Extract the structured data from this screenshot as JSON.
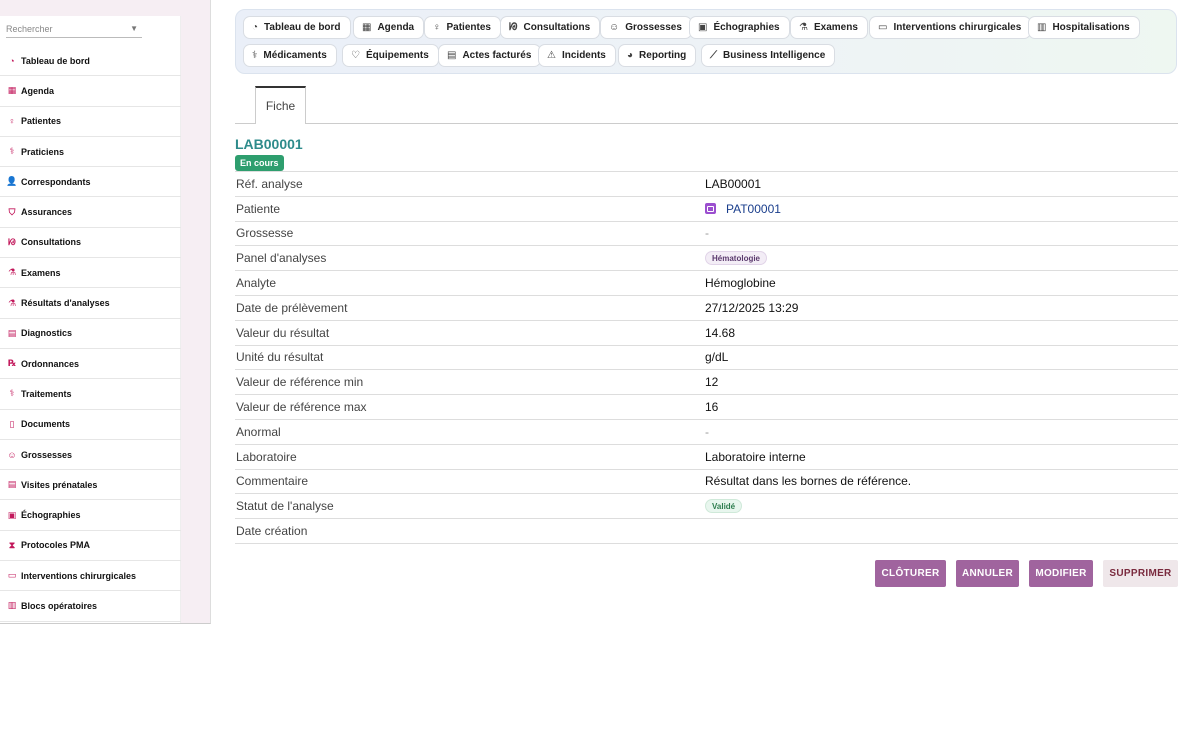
{
  "search": {
    "placeholder": "Rechercher"
  },
  "sidebar": {
    "items": [
      {
        "label": "Tableau de bord",
        "icon": "gauge-icon",
        "glyph": "◔"
      },
      {
        "label": "Agenda",
        "icon": "calendar-icon",
        "glyph": "▦"
      },
      {
        "label": "Patientes",
        "icon": "female-icon",
        "glyph": "♀"
      },
      {
        "label": "Praticiens",
        "icon": "doctor-icon",
        "glyph": "⚕"
      },
      {
        "label": "Correspondants",
        "icon": "user-icon",
        "glyph": "👤"
      },
      {
        "label": "Assurances",
        "icon": "shield-icon",
        "glyph": "⛉"
      },
      {
        "label": "Consultations",
        "icon": "stethoscope-icon",
        "glyph": "ᘘ"
      },
      {
        "label": "Examens",
        "icon": "microscope-icon",
        "glyph": "⚗"
      },
      {
        "label": "Résultats d'analyses",
        "icon": "flask-icon",
        "glyph": "⚗"
      },
      {
        "label": "Diagnostics",
        "icon": "clipboard-icon",
        "glyph": "▤"
      },
      {
        "label": "Ordonnances",
        "icon": "prescription-icon",
        "glyph": "℞"
      },
      {
        "label": "Traitements",
        "icon": "pills-icon",
        "glyph": "⚕"
      },
      {
        "label": "Documents",
        "icon": "file-icon",
        "glyph": "▯"
      },
      {
        "label": "Grossesses",
        "icon": "baby-icon",
        "glyph": "☺"
      },
      {
        "label": "Visites prénatales",
        "icon": "clipboard-check-icon",
        "glyph": "▤"
      },
      {
        "label": "Échographies",
        "icon": "monitor-icon",
        "glyph": "▣"
      },
      {
        "label": "Protocoles PMA",
        "icon": "hourglass-icon",
        "glyph": "⧗"
      },
      {
        "label": "Interventions chirurgicales",
        "icon": "bed-icon",
        "glyph": "▭"
      },
      {
        "label": "Blocs opératoires",
        "icon": "hospital-icon",
        "glyph": "▥"
      }
    ]
  },
  "topnav": {
    "items": [
      {
        "label": "Tableau de bord",
        "icon": "gauge-icon",
        "glyph": "◔"
      },
      {
        "label": "Agenda",
        "icon": "calendar-icon",
        "glyph": "▦"
      },
      {
        "label": "Patientes",
        "icon": "female-icon",
        "glyph": "♀"
      },
      {
        "label": "Consultations",
        "icon": "stethoscope-icon",
        "glyph": "ᘘ"
      },
      {
        "label": "Grossesses",
        "icon": "baby-icon",
        "glyph": "☺"
      },
      {
        "label": "Échographies",
        "icon": "monitor-icon",
        "glyph": "▣"
      },
      {
        "label": "Examens",
        "icon": "microscope-icon",
        "glyph": "⚗"
      },
      {
        "label": "Interventions chirurgicales",
        "icon": "bed-icon",
        "glyph": "▭"
      },
      {
        "label": "Hospitalisations",
        "icon": "hospital-user-icon",
        "glyph": "▥"
      },
      {
        "label": "Médicaments",
        "icon": "pills-icon",
        "glyph": "⚕"
      },
      {
        "label": "Équipements",
        "icon": "heart-pulse-icon",
        "glyph": "♡"
      },
      {
        "label": "Actes facturés",
        "icon": "invoice-icon",
        "glyph": "▤"
      },
      {
        "label": "Incidents",
        "icon": "warning-icon",
        "glyph": "⚠"
      },
      {
        "label": "Reporting",
        "icon": "pie-chart-icon",
        "glyph": "◕"
      },
      {
        "label": "Business Intelligence",
        "icon": "line-chart-icon",
        "glyph": "⟋"
      }
    ]
  },
  "tabs": {
    "fiche": "Fiche"
  },
  "record": {
    "title": "LAB00001",
    "status": "En cours",
    "fields": [
      {
        "label": "Réf. analyse",
        "value": "LAB00001"
      },
      {
        "label": "Patiente",
        "value": "PAT00001"
      },
      {
        "label": "Grossesse",
        "value": "-"
      },
      {
        "label": "Panel d'analyses",
        "value": "Hématologie"
      },
      {
        "label": "Analyte",
        "value": "Hémoglobine"
      },
      {
        "label": "Date de prélèvement",
        "value": "27/12/2025 13:29"
      },
      {
        "label": "Valeur du résultat",
        "value": "14.68"
      },
      {
        "label": "Unité du résultat",
        "value": "g/dL"
      },
      {
        "label": "Valeur de référence min",
        "value": "12"
      },
      {
        "label": "Valeur de référence max",
        "value": "16"
      },
      {
        "label": "Anormal",
        "value": "-"
      },
      {
        "label": "Laboratoire",
        "value": "Laboratoire interne"
      },
      {
        "label": "Commentaire",
        "value": "Résultat dans les bornes de référence."
      },
      {
        "label": "Statut de l'analyse",
        "value": "Validé"
      },
      {
        "label": "Date création",
        "value": ""
      }
    ]
  },
  "actions": {
    "cloturer": "CLÔTURER",
    "annuler": "ANNULER",
    "modifier": "MODIFIER",
    "supprimer": "SUPPRIMER"
  },
  "colors": {
    "accent": "#a0649e",
    "title": "#2e8b8b",
    "status_green": "#2e9e6e",
    "sidebar_icon": "#c2185b"
  }
}
